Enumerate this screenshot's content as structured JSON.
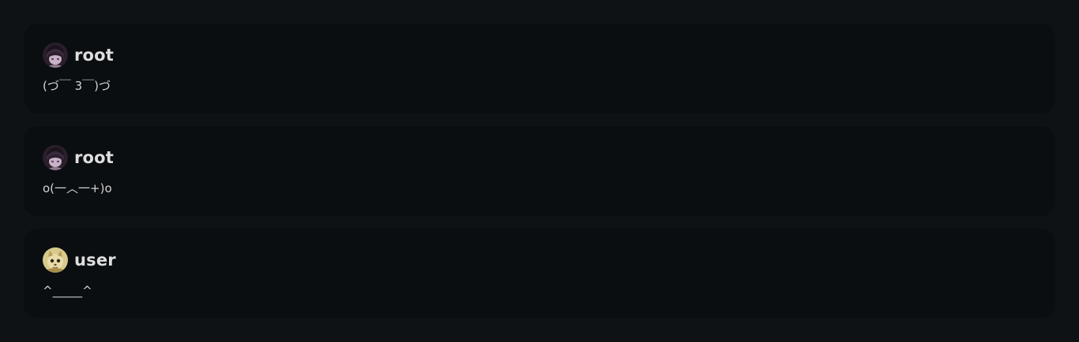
{
  "comments": [
    {
      "username": "root",
      "avatar_icon": "anime-girl-avatar-icon",
      "message": "(づ￣ 3￣)づ"
    },
    {
      "username": "root",
      "avatar_icon": "anime-girl-avatar-icon",
      "message": "o(一︿一+)o"
    },
    {
      "username": "user",
      "avatar_icon": "cat-avatar-icon",
      "message": "^_____^"
    }
  ],
  "colors": {
    "page_background": "#0e1215",
    "card_background": "#0a0e11",
    "username_text": "#dedede",
    "message_text": "#d2d2d2"
  }
}
